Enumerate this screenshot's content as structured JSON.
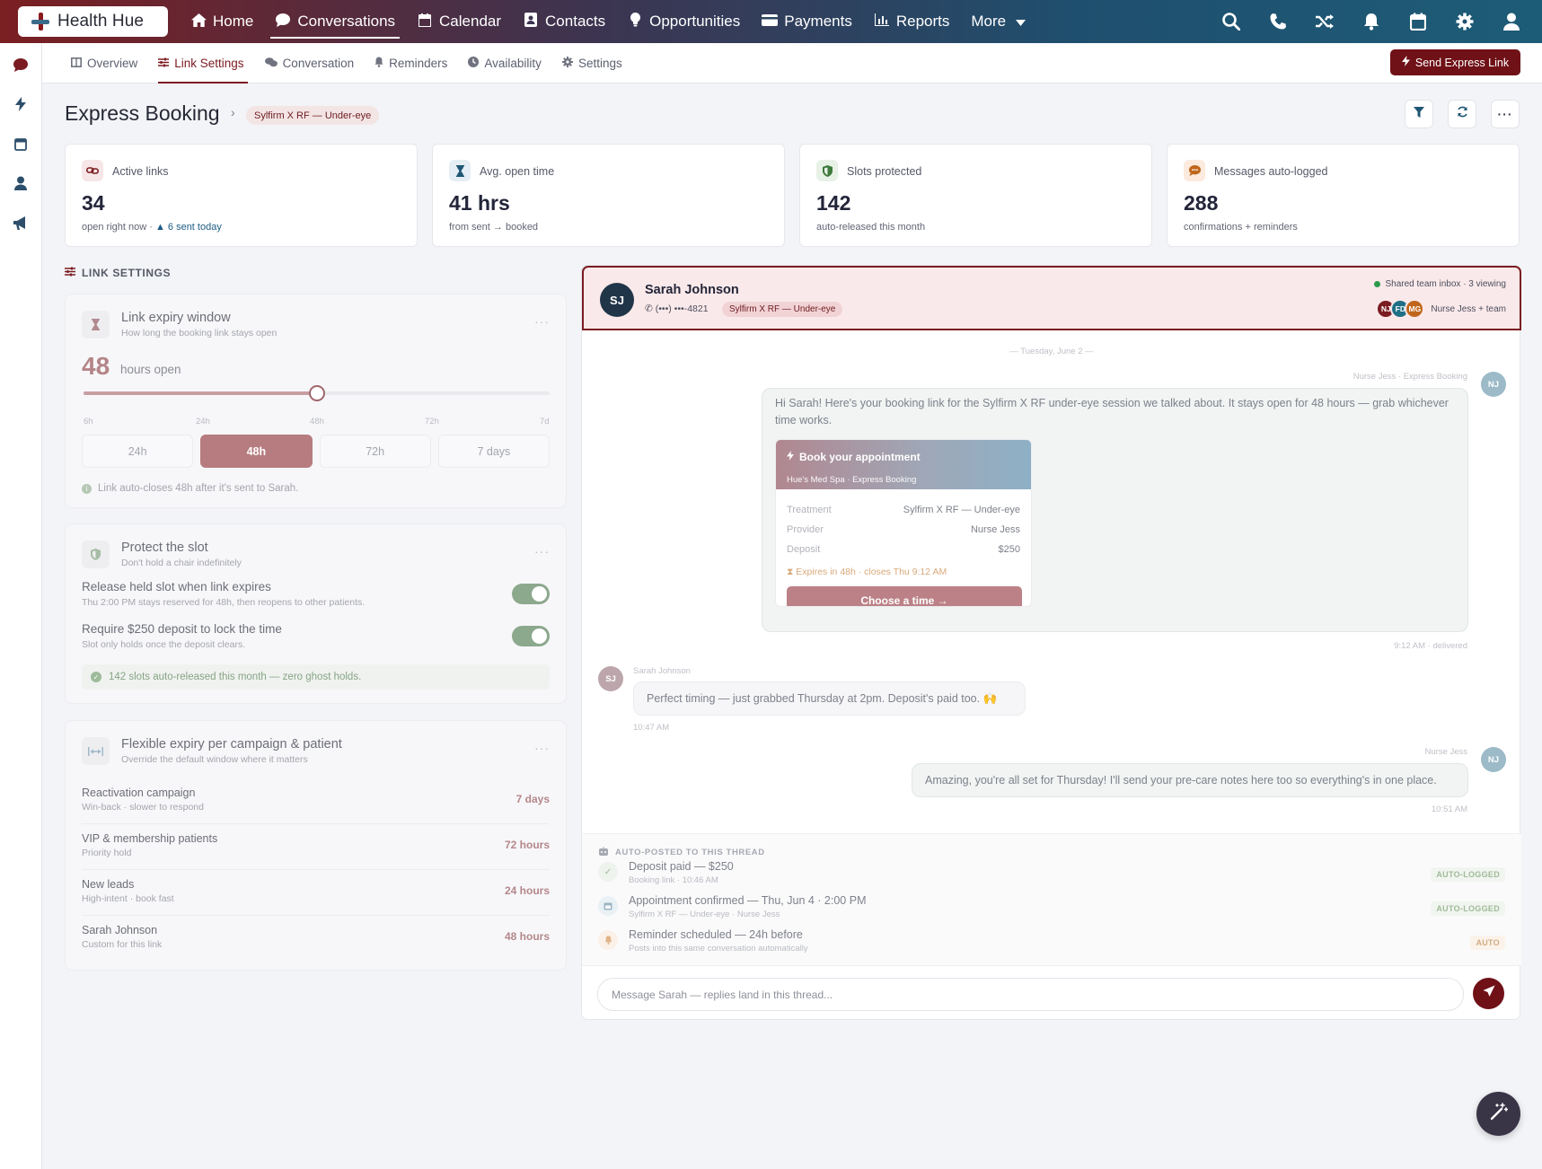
{
  "app": {
    "logo_text": "Health Hue"
  },
  "topnav": {
    "items": [
      {
        "label": "Home",
        "icon": "home-icon"
      },
      {
        "label": "Conversations",
        "icon": "chat-icon",
        "active": true
      },
      {
        "label": "Calendar",
        "icon": "calendar-icon"
      },
      {
        "label": "Contacts",
        "icon": "contact-card-icon"
      },
      {
        "label": "Opportunities",
        "icon": "lightbulb-icon"
      },
      {
        "label": "Payments",
        "icon": "credit-card-icon"
      },
      {
        "label": "Reports",
        "icon": "bar-chart-icon"
      },
      {
        "label": "More",
        "icon": "caret-down-icon"
      }
    ],
    "right_icons": [
      "search-icon",
      "phone-icon",
      "shuffle-icon",
      "bell-icon",
      "calendar-icon",
      "gear-icon",
      "user-icon"
    ]
  },
  "rail": {
    "icons": [
      "chat-icon",
      "bolt-icon",
      "calendar-icon",
      "user-icon",
      "megaphone-icon"
    ]
  },
  "subnav": {
    "tabs": [
      {
        "label": "Overview",
        "icon": "overview-icon"
      },
      {
        "label": "Link Settings",
        "icon": "sliders-icon",
        "active": true
      },
      {
        "label": "Conversation",
        "icon": "comments-icon"
      },
      {
        "label": "Reminders",
        "icon": "bell-icon"
      },
      {
        "label": "Availability",
        "icon": "clock-icon"
      },
      {
        "label": "Settings",
        "icon": "gear-icon"
      }
    ],
    "express_button": "Send Express Link"
  },
  "header": {
    "title": "Express Booking",
    "breadcrumb_chip": "Sylfirm X RF — Under-eye",
    "actions": [
      "filter-icon",
      "refresh-icon",
      "more-icon"
    ]
  },
  "stats": [
    {
      "label": "Active links",
      "value": "34",
      "sub": "open right now ·",
      "sub_up": "▲ 6 sent today",
      "icon": "link-icon"
    },
    {
      "label": "Avg. open time",
      "value": "41 hrs",
      "sub": "from sent → booked",
      "icon": "hourglass-icon"
    },
    {
      "label": "Slots protected",
      "value": "142",
      "sub": "auto-released this month",
      "icon": "shield-icon"
    },
    {
      "label": "Messages auto-logged",
      "value": "288",
      "sub": "confirmations + reminders",
      "icon": "message-icon"
    }
  ],
  "link_settings": {
    "section_label": "LINK SETTINGS",
    "expiry": {
      "title": "Link expiry window",
      "subtitle": "How long the booking link stays open",
      "value": "48",
      "unit": "hours open",
      "slider_position": 0.5,
      "ticks": [
        "6h",
        "24h",
        "48h",
        "72h",
        "7d"
      ],
      "options": [
        "24h",
        "48h",
        "72h",
        "7 days"
      ],
      "selected_option": "48h",
      "note": "Link auto-closes 48h after it's sent to Sarah."
    },
    "protect": {
      "title": "Protect the slot",
      "subtitle": "Don't hold a chair indefinitely",
      "toggles": [
        {
          "title": "Release held slot when link expires",
          "sub": "Thu 2:00 PM stays reserved for 48h, then reopens to other patients.",
          "on": true
        },
        {
          "title": "Require $250 deposit to lock the time",
          "sub": "Slot only holds once the deposit clears.",
          "on": true
        }
      ],
      "summary": "142 slots auto-released this month — zero ghost holds."
    },
    "flexible": {
      "title": "Flexible expiry per campaign & patient",
      "subtitle": "Override the default window where it matters",
      "rows": [
        {
          "label": "Reactivation campaign",
          "sub": "Win-back · slower to respond",
          "value": "7 days"
        },
        {
          "label": "VIP & membership patients",
          "sub": "Priority hold",
          "value": "72 hours"
        },
        {
          "label": "New leads",
          "sub": "High-intent · book fast",
          "value": "24 hours"
        },
        {
          "label": "Sarah Johnson",
          "sub": "Custom for this link",
          "value": "48 hours"
        }
      ]
    }
  },
  "chat": {
    "contact": {
      "initials": "SJ",
      "name": "Sarah Johnson",
      "phone": "(•••) •••-4821",
      "chip": "Sylfirm X RF — Under-eye",
      "inbox": "Shared team inbox · 3 viewing",
      "team_avatars": [
        {
          "initials": "NJ",
          "color": "#7a1c22"
        },
        {
          "initials": "FD",
          "color": "#1f6f86"
        },
        {
          "initials": "MG",
          "color": "#c0661c"
        }
      ],
      "team_label": "Nurse Jess + team"
    },
    "date_divider": "— Tuesday, June 2 —",
    "messages": [
      {
        "from": "Nurse Jess · Express Booking",
        "avatar": "NJ",
        "text": "Hi Sarah! Here's your booking link for the Sylfirm X RF under-eye session we talked about. It stays open for 48 hours — grab whichever time works.",
        "time": "9:12 AM · delivered",
        "card": {
          "title": "Book your appointment",
          "subtitle": "Hue's Med Spa · Express Booking",
          "rows": [
            {
              "k": "Treatment",
              "v": "Sylfirm X RF — Under-eye"
            },
            {
              "k": "Provider",
              "v": "Nurse Jess"
            },
            {
              "k": "Deposit",
              "v": "$250"
            }
          ],
          "expires": "Expires in 48h · closes Thu 9:12 AM",
          "cta": "Choose a time →"
        }
      },
      {
        "from": "Sarah Johnson",
        "avatar": "SJ",
        "text": "Perfect timing — just grabbed Thursday at 2pm. Deposit's paid too. 🙌",
        "time": "10:47 AM"
      },
      {
        "from": "Nurse Jess",
        "avatar": "NJ",
        "text": "Amazing, you're all set for Thursday! I'll send your pre-care notes here too so everything's in one place.",
        "time": "10:51 AM"
      }
    ],
    "auto_section": {
      "label": "AUTO-POSTED TO THIS THREAD",
      "rows": [
        {
          "title": "Deposit paid — $250",
          "sub": "Booking link · 10:46 AM",
          "badge": "AUTO-LOGGED",
          "icon": "check-icon"
        },
        {
          "title": "Appointment confirmed — Thu, Jun 4 · 2:00 PM",
          "sub": "Sylfirm X RF — Under-eye · Nurse Jess",
          "badge": "AUTO-LOGGED",
          "icon": "calendar-icon"
        },
        {
          "title": "Reminder scheduled — 24h before",
          "sub": "Posts into this same conversation automatically",
          "badge": "AUTO",
          "icon": "bell-icon"
        }
      ]
    },
    "composer_placeholder": "Message Sarah — replies land in this thread..."
  }
}
